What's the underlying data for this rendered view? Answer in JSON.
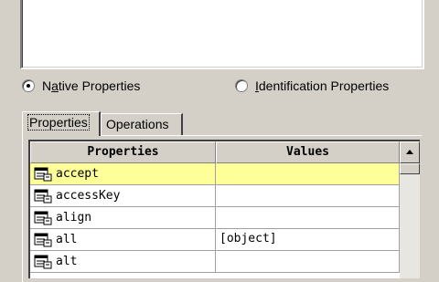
{
  "radios": {
    "native": {
      "label_prefix": "N",
      "label_mnemonic": "a",
      "label_rest": "tive Properties",
      "checked": true
    },
    "identification": {
      "label_mnemonic": "I",
      "label_rest": "dentification Properties",
      "checked": false
    }
  },
  "tabs": [
    {
      "label": "Properties",
      "active": true
    },
    {
      "label": "Operations",
      "active": false
    }
  ],
  "grid": {
    "headers": {
      "properties": "Properties",
      "values": "Values"
    },
    "rows": [
      {
        "name": "accept",
        "value": "",
        "selected": true
      },
      {
        "name": "accessKey",
        "value": ""
      },
      {
        "name": "align",
        "value": ""
      },
      {
        "name": "all",
        "value": "[object]"
      },
      {
        "name": "alt",
        "value": ""
      }
    ]
  },
  "icons": {
    "property": "property-list-icon"
  }
}
